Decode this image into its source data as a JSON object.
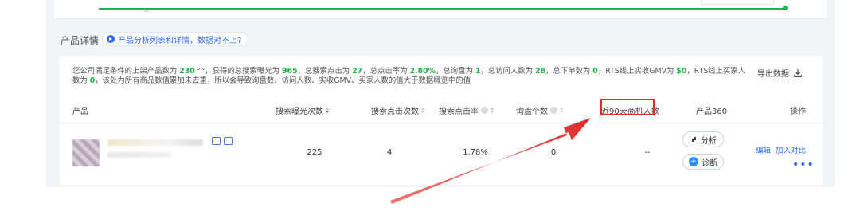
{
  "section": {
    "title": "产品详情",
    "hint_link": "产品分析列表和详情，数据对不上?"
  },
  "summary": {
    "p1": "您公司满足条件的上架产品数为",
    "v1": "230",
    "p2": "个，获得的总搜索曝光为",
    "v2": "965",
    "p3": "，总搜索点击为",
    "v3": "27",
    "p4": "，总点击率为",
    "v4": "2.80%",
    "p5": "，总询盘为",
    "v5": "1",
    "p6": "，总访问人数为",
    "v6": "28",
    "p7": "，总下单数为",
    "v7": "0",
    "p8": "，RTS线上实收GMV为",
    "v8": "$0",
    "p9": "，RTS线上买家人数为",
    "v9": "0",
    "p10": "，该处为所有商品数值累加未去重，所以会导致询盘数、访问人数、实收GMV、买家人数的值大于数据概览中的值"
  },
  "export_label": "导出数据",
  "columns": {
    "product": "产品",
    "search_exposure": "搜索曝光次数",
    "search_clicks": "搜索点击次数",
    "search_ctr": "搜索点击率",
    "inquiries": "询盘个数",
    "buyers_90d": "近90天商机人数",
    "product360": "产品360",
    "actions": "操作"
  },
  "rows": [
    {
      "search_exposure": "225",
      "search_clicks": "4",
      "search_ctr": "1.78%",
      "inquiries": "0",
      "buyers_90d": "--",
      "analyze_label": "分析",
      "diagnose_label": "诊断",
      "edit_label": "编辑",
      "compare_label": "加入对比",
      "more_label": "•••"
    }
  ],
  "colors": {
    "highlight_green": "#23b14d",
    "link_blue": "#2f6bf0",
    "annotation_red": "#e0292a"
  }
}
